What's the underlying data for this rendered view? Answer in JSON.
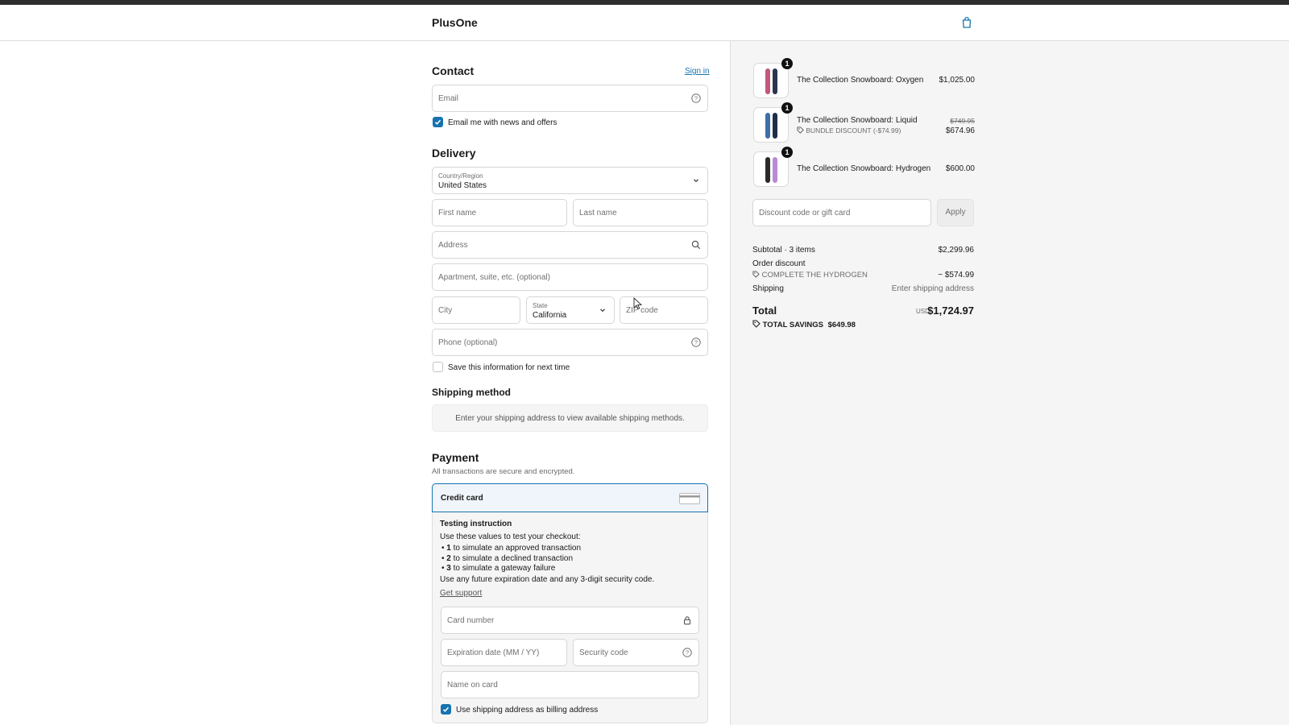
{
  "header": {
    "brand": "PlusOne",
    "cart_icon": "shopping-bag-icon"
  },
  "contact": {
    "title": "Contact",
    "sign_in": "Sign in",
    "email_placeholder": "Email",
    "news_label": "Email me with news and offers",
    "news_checked": true
  },
  "delivery": {
    "title": "Delivery",
    "country_label": "Country/Region",
    "country_value": "United States",
    "first_name": "First name",
    "last_name": "Last name",
    "address": "Address",
    "apartment": "Apartment, suite, etc. (optional)",
    "city": "City",
    "state_label": "State",
    "state_value": "California",
    "zip": "ZIP code",
    "phone": "Phone (optional)",
    "save_label": "Save this information for next time",
    "save_checked": false
  },
  "shipping": {
    "title": "Shipping method",
    "notice": "Enter your shipping address to view available shipping methods."
  },
  "payment": {
    "title": "Payment",
    "subtitle": "All transactions are secure and encrypted.",
    "method": "Credit card",
    "testing_title": "Testing instruction",
    "testing_intro": "Use these values to test your checkout:",
    "testing_items": [
      {
        "num": "1",
        "text": " to simulate an approved transaction"
      },
      {
        "num": "2",
        "text": " to simulate a declined transaction"
      },
      {
        "num": "3",
        "text": " to simulate a gateway failure"
      }
    ],
    "testing_note": "Use any future expiration date and any 3-digit security code.",
    "support_link": "Get support",
    "card_number": "Card number",
    "expiration": "Expiration date (MM / YY)",
    "security_code": "Security code",
    "name_on_card": "Name on card",
    "billing_label": "Use shipping address as billing address",
    "billing_checked": true
  },
  "summary": {
    "items": [
      {
        "name": "The Collection Snowboard: Oxygen",
        "qty": "1",
        "price": "$1,025.00",
        "colors": [
          "#c2587a",
          "#2b3550"
        ]
      },
      {
        "name": "The Collection Snowboard: Liquid",
        "qty": "1",
        "original_price": "$749.95",
        "price": "$674.96",
        "discount": "BUNDLE DISCOUNT (-$74.99)",
        "colors": [
          "#3d6fa8",
          "#1e2d4a"
        ]
      },
      {
        "name": "The Collection Snowboard: Hydrogen",
        "qty": "1",
        "price": "$600.00",
        "colors": [
          "#2a2a2a",
          "#b88ad6"
        ]
      }
    ],
    "discount_placeholder": "Discount code or gift card",
    "apply": "Apply",
    "subtotal_label": "Subtotal · 3 items",
    "subtotal_value": "$2,299.96",
    "order_discount_label": "Order discount",
    "order_discount_code": "COMPLETE THE HYDROGEN",
    "order_discount_value": "− $574.99",
    "shipping_label": "Shipping",
    "shipping_value": "Enter shipping address",
    "total_label": "Total",
    "currency": "USD",
    "total_value": "$1,724.97",
    "savings_label": "TOTAL SAVINGS",
    "savings_value": "$649.98"
  },
  "colors": {
    "accent": "#1773b0",
    "muted": "#707070"
  }
}
